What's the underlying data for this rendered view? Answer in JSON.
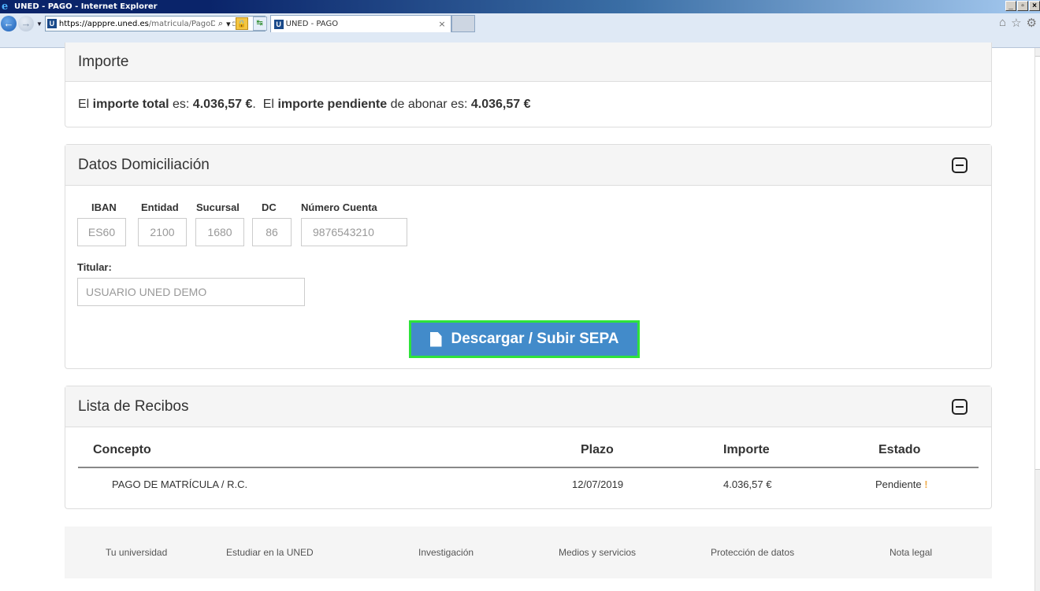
{
  "window": {
    "title": "UNED - PAGO - Internet Explorer",
    "controls": [
      "_",
      "▫",
      "×"
    ]
  },
  "browser": {
    "url_host": "https://apppre.uned.es",
    "url_path": "/matricula/PagoDomic",
    "favicon_letter": "U",
    "tab_title": "UNED - PAGO",
    "tab_close": "×"
  },
  "importe": {
    "heading": "Importe",
    "text_1": "El ",
    "bold_1": "importe total",
    "text_2": " es: ",
    "amount_total": "4.036,57 €",
    "text_3": ".  El ",
    "bold_2": "importe pendiente",
    "text_4": " de abonar es: ",
    "amount_pendiente": "4.036,57 €"
  },
  "domiciliacion": {
    "heading": "Datos Domiciliación",
    "labels": {
      "iban": "IBAN",
      "entidad": "Entidad",
      "sucursal": "Sucursal",
      "dc": "DC",
      "numero_cuenta": "Número Cuenta",
      "titular": "Titular:"
    },
    "values": {
      "iban": "ES60",
      "entidad": "2100",
      "sucursal": "1680",
      "dc": "86",
      "numero_cuenta": "9876543210",
      "titular": "USUARIO UNED DEMO"
    },
    "sepa_button": "Descargar / Subir SEPA"
  },
  "recibos": {
    "heading": "Lista de Recibos",
    "columns": [
      "Concepto",
      "Plazo",
      "Importe",
      "Estado"
    ],
    "rows": [
      {
        "concepto": "PAGO DE MATRÍCULA / R.C.",
        "plazo": "12/07/2019",
        "importe": "4.036,57 €",
        "estado": "Pendiente",
        "estado_mark": "!"
      }
    ]
  },
  "footer": {
    "links": [
      "Tu universidad",
      "Estudiar en la UNED",
      "Investigación",
      "Medios y servicios",
      "Protección de datos",
      "Nota legal"
    ]
  },
  "colors": {
    "primary_button": "#428bca",
    "button_highlight": "#2ee33a",
    "warning": "#f0ad4e"
  }
}
